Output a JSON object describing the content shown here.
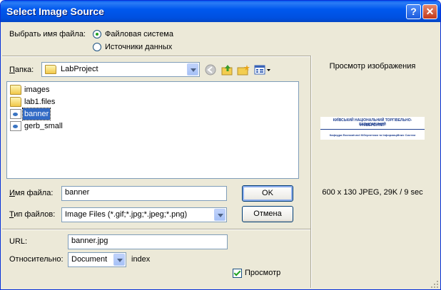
{
  "window": {
    "title": "Select Image Source",
    "help_label": "?",
    "close_label": "✕"
  },
  "source": {
    "label": "Выбрать имя файла:",
    "option_fs": "Файловая система",
    "option_ds": "Источники данных",
    "selected": "Файловая система"
  },
  "folder": {
    "label": "Папка:",
    "value": "LabProject"
  },
  "files": [
    {
      "name": "images",
      "icon": "folder-icon"
    },
    {
      "name": "lab1.files",
      "icon": "folder-icon"
    },
    {
      "name": "banner",
      "icon": "image-file-icon",
      "selected": true
    },
    {
      "name": "gerb_small",
      "icon": "image-file-icon"
    }
  ],
  "filename": {
    "label": "Имя файла:",
    "value": "banner"
  },
  "filetype": {
    "label": "Тип файлов:",
    "value": "Image Files (*.gif;*.jpg;*.jpeg;*.png)"
  },
  "buttons": {
    "ok": "OK",
    "cancel": "Отмена"
  },
  "url": {
    "label": "URL:",
    "value": "banner.jpg"
  },
  "relative": {
    "label": "Относительно:",
    "value": "Document",
    "suffix": "index"
  },
  "preview": {
    "title": "Просмотр изображения",
    "checkbox_label": "Просмотр",
    "checked": true,
    "info": "600 x 130 JPEG, 29K / 9 sec",
    "banner_line1": "КИЇВСЬКИЙ НАЦІОНАЛЬНИЙ ТОРГІВЕЛЬНО-ЕКОНОМІЧНИЙ",
    "banner_line2": "УНІВЕРСИТЕТ",
    "banner_line3": "Кафедра Економічної Кібернетики та Інформаційних Систем"
  },
  "colors": {
    "title_bar": "#0058ee",
    "selection": "#316ac5",
    "window_bg": "#ece9d8"
  }
}
